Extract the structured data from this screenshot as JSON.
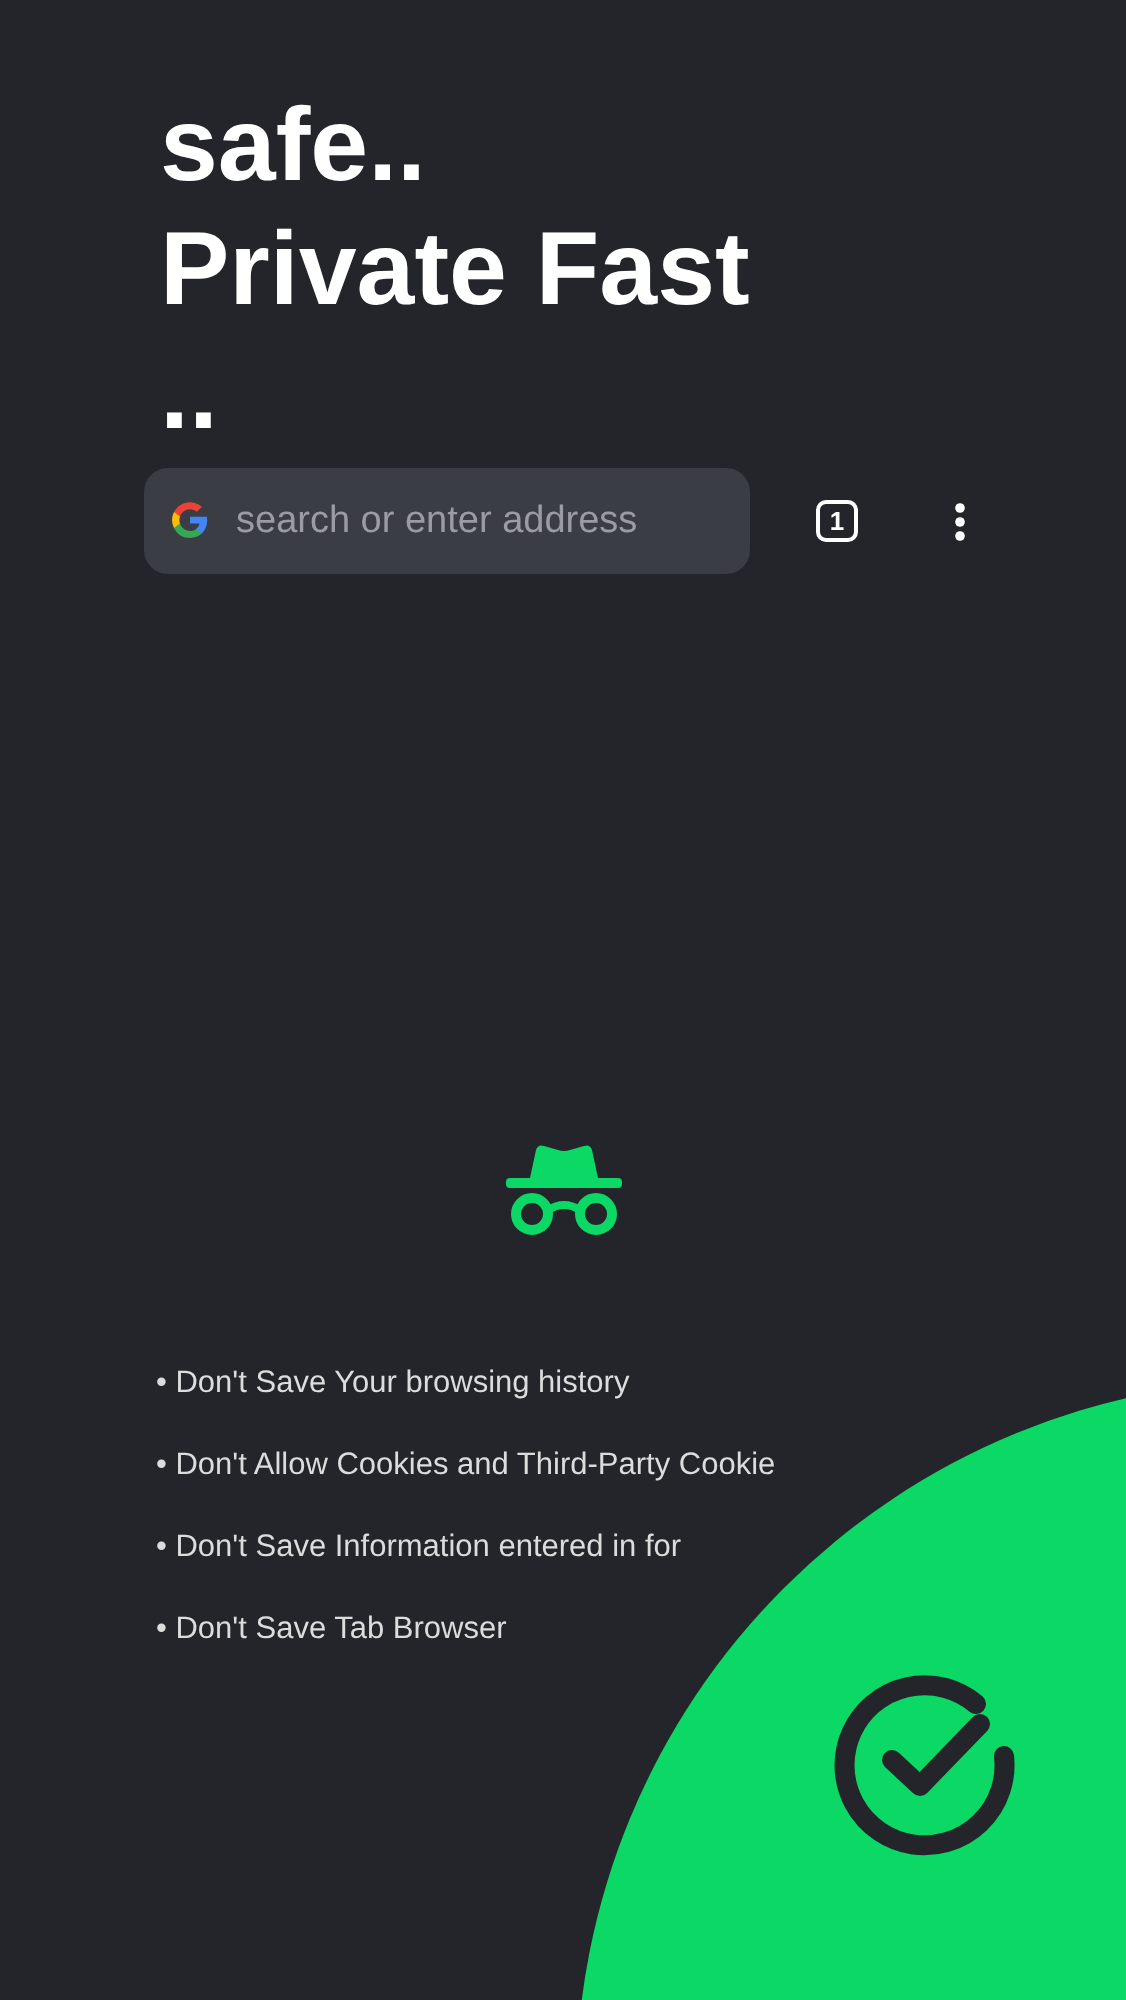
{
  "headline": {
    "lines": [
      "safe..",
      "Private Fast",
      ".."
    ]
  },
  "address_bar": {
    "placeholder": "search or enter address"
  },
  "tab_count": "1",
  "privacy_notes": [
    "• Don't Save Your browsing history",
    "• Don't Allow Cookies and Third-Party Cookie",
    "• Don't Save Information entered in for",
    "• Don't Save Tab Browser"
  ]
}
